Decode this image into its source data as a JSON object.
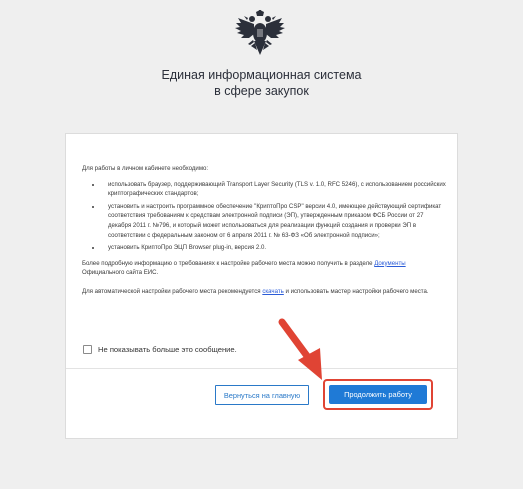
{
  "header": {
    "title_line1": "Единая информационная система",
    "title_line2": "в сфере закупок",
    "emblem_icon": "double-headed-eagle-icon"
  },
  "dialog": {
    "intro": "Для работы в личном кабинете необходимо:",
    "requirements": [
      "использовать браузер, поддерживающий Transport Layer Security (TLS v. 1.0, RFC 5246), с использованием российских криптографических стандартов;",
      "установить и настроить программное обеспечение \"КриптоПро CSP\" версии 4.0, имеющее действующий сертификат соответствия требованиям к средствам электронной подписи (ЭП), утвержденным приказом ФСБ России от 27 декабря 2011 г. №796, и который может использоваться для реализации функций создания и проверки ЭП в соответствии с федеральным законом от 6 апреля 2011 г. № 63-ФЗ «Об электронной подписи»;",
      "установить КриптоПро ЭЦП Browser plug-in, версия 2.0."
    ],
    "more_info_before": "Более подробную информацию о требованиях к настройке рабочего места можно получить в разделе ",
    "more_info_link": "Документы",
    "more_info_after": " Официального сайта ЕИС.",
    "auto_setup_before": "Для автоматической настройки рабочего места рекомендуется ",
    "auto_setup_link": "скачать",
    "auto_setup_after": " и использовать мастер настройки рабочего места.",
    "dont_show_label": "Не показывать больше это сообщение.",
    "dont_show_checked": false,
    "back_button": "Вернуться на главную",
    "continue_button": "Продолжить работу"
  },
  "colors": {
    "primary": "#1f7ad6",
    "highlight": "#e04434",
    "link": "#2a5bd7",
    "background": "#efefef"
  }
}
